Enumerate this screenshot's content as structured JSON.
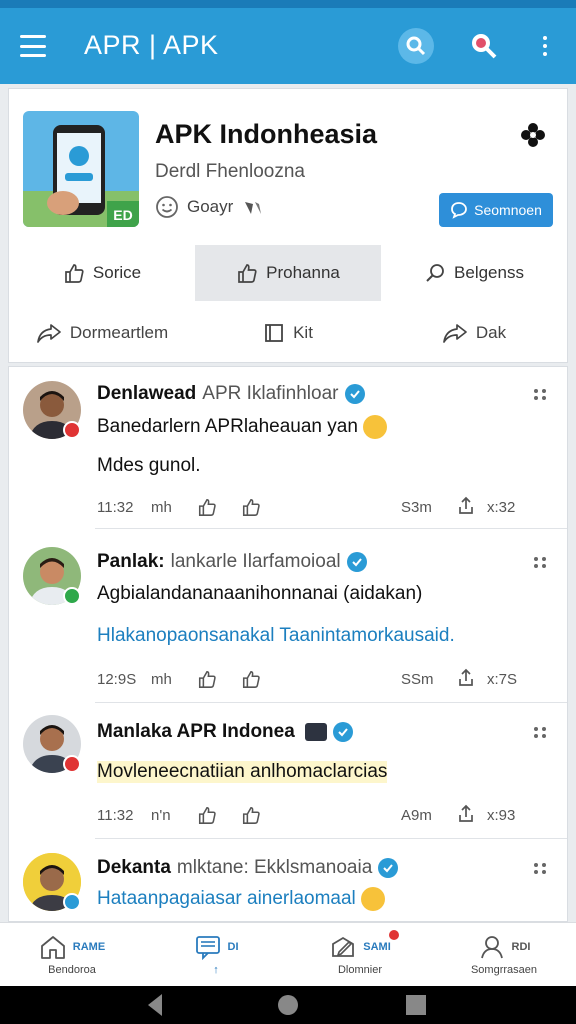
{
  "appbar": {
    "title": "APR | APK",
    "menu_icon": "hamburger-menu-icon",
    "icons": [
      "search-icon",
      "search-icon",
      "more-vertical-icon"
    ],
    "color": "#2a9bd6"
  },
  "profile": {
    "app_name": "APK Indonheasia",
    "developer": "Derdl Fhenloozna",
    "rating_text": "Goayr",
    "subscribe_label": "Seomnoen",
    "accent": "#2e8fd9",
    "icon_badge": "ED",
    "tabs": [
      {
        "label": "Sorice",
        "icon": "like-icon",
        "active": false
      },
      {
        "label": "Prohanna",
        "icon": "like-icon",
        "active": true
      },
      {
        "label": "Belgenss",
        "icon": "search-icon",
        "active": false
      }
    ],
    "actions": [
      {
        "label": "Dormeartlem",
        "icon": "share-icon"
      },
      {
        "label": "Kit",
        "icon": "bookmark-icon"
      },
      {
        "label": "Dak",
        "icon": "share-icon"
      }
    ]
  },
  "posts": [
    {
      "name": "Denlawead",
      "sub": "APR Iklafinhloar",
      "text": "Banedarlern APRlaheauan yan",
      "text2": "Mdes gunol.",
      "time": "11:32",
      "mh": "mh",
      "count": "S3m",
      "x": "x:32",
      "badge_color": "#e03434"
    },
    {
      "name": "Panlak:",
      "sub": "lankarle Ilarfamoioal",
      "text": "Agbialandananaanihonnanai (aidakan)",
      "text2": "Hlakanopaonsanakal Taanintamorkausaid.",
      "time": "12:9S",
      "mh": "mh",
      "count": "SSm",
      "x": "x:7S",
      "badge_color": "#2ea84a"
    },
    {
      "name": "Manlaka APR Indonea",
      "sub": "",
      "text": "Movleneecnatiian anlhomaclarcias",
      "text2": "",
      "time": "11:32",
      "mh": "n'n",
      "count": "A9m",
      "x": "x:93",
      "badge_color": "#e03434"
    },
    {
      "name": "Dekanta",
      "sub": "mlktane: Ekklsmanoaia",
      "text": "Hataanpagaiasar ainerlaomaal",
      "text2": "",
      "time": "",
      "mh": "",
      "count": "",
      "x": "",
      "badge_color": "#2a9bd6"
    }
  ],
  "bottom_nav": [
    {
      "top": "RAME",
      "label": "Bendoroa",
      "icon": "home-icon"
    },
    {
      "top": "DI",
      "label": "↑",
      "icon": "message-icon"
    },
    {
      "top": "SAMI",
      "label": "Dlomnier",
      "icon": "edit-icon"
    },
    {
      "top": "RDI",
      "label": "Somgrrasaen",
      "icon": "profile-icon"
    }
  ]
}
